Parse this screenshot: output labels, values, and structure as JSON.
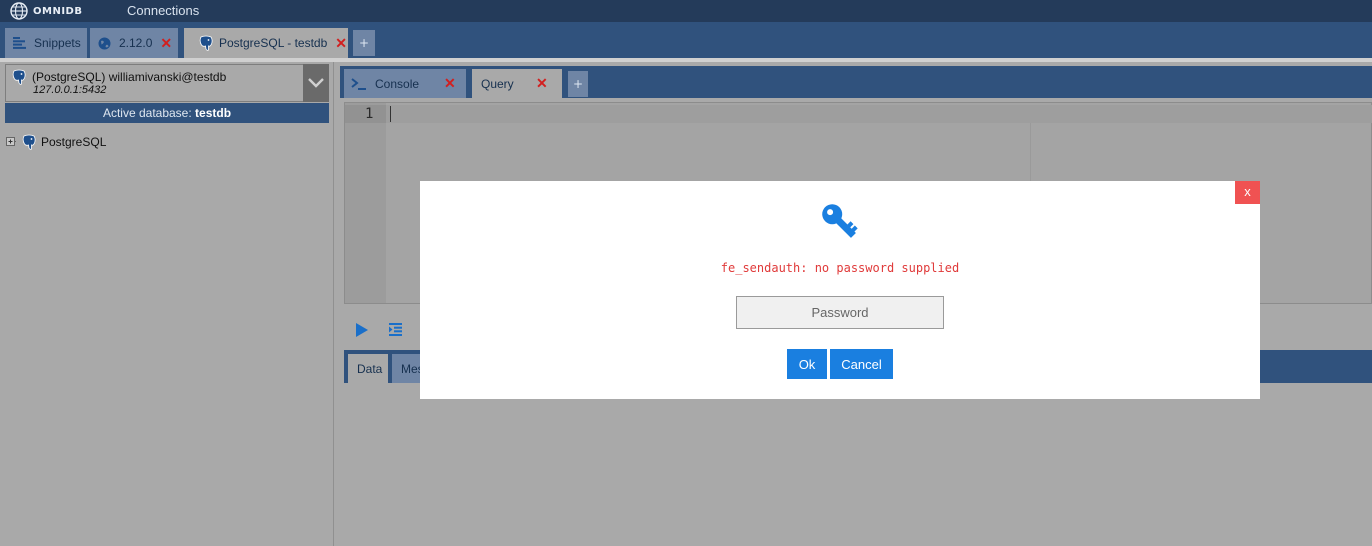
{
  "topbar": {
    "brand": "OMNIDB",
    "menu_connections": "Connections"
  },
  "main_tabs": [
    {
      "label": "Snippets",
      "icon": "snippets-icon",
      "closable": false
    },
    {
      "label": "2.12.0",
      "icon": "globe-icon",
      "closable": true
    },
    {
      "label": "PostgreSQL - testdb",
      "icon": "postgresql-elephant-icon",
      "closable": true,
      "active": true
    }
  ],
  "main_tab_add": "+",
  "connection": {
    "title": "(PostgreSQL) williamivanski@testdb",
    "host": "127.0.0.1:5432",
    "active_db_prefix": "Active database:",
    "active_db_name": "testdb"
  },
  "tree": {
    "root_label": "PostgreSQL"
  },
  "inner_tabs": [
    {
      "label": "Console",
      "icon": "console-icon",
      "closable": true
    },
    {
      "label": "Query",
      "closable": true,
      "active": true
    }
  ],
  "inner_tab_add": "+",
  "editor": {
    "line_number": "1"
  },
  "result_tabs": [
    "Data",
    "Mes"
  ],
  "modal": {
    "close_label": "x",
    "error_message": "fe_sendauth: no password supplied",
    "password_placeholder": "Password",
    "ok_label": "Ok",
    "cancel_label": "Cancel"
  },
  "colors": {
    "accent_blue": "#1a7fe0",
    "error_red": "#e03a3a",
    "close_red": "#f05252",
    "nav_dark": "#243b5a",
    "nav_blue": "#30527d"
  }
}
